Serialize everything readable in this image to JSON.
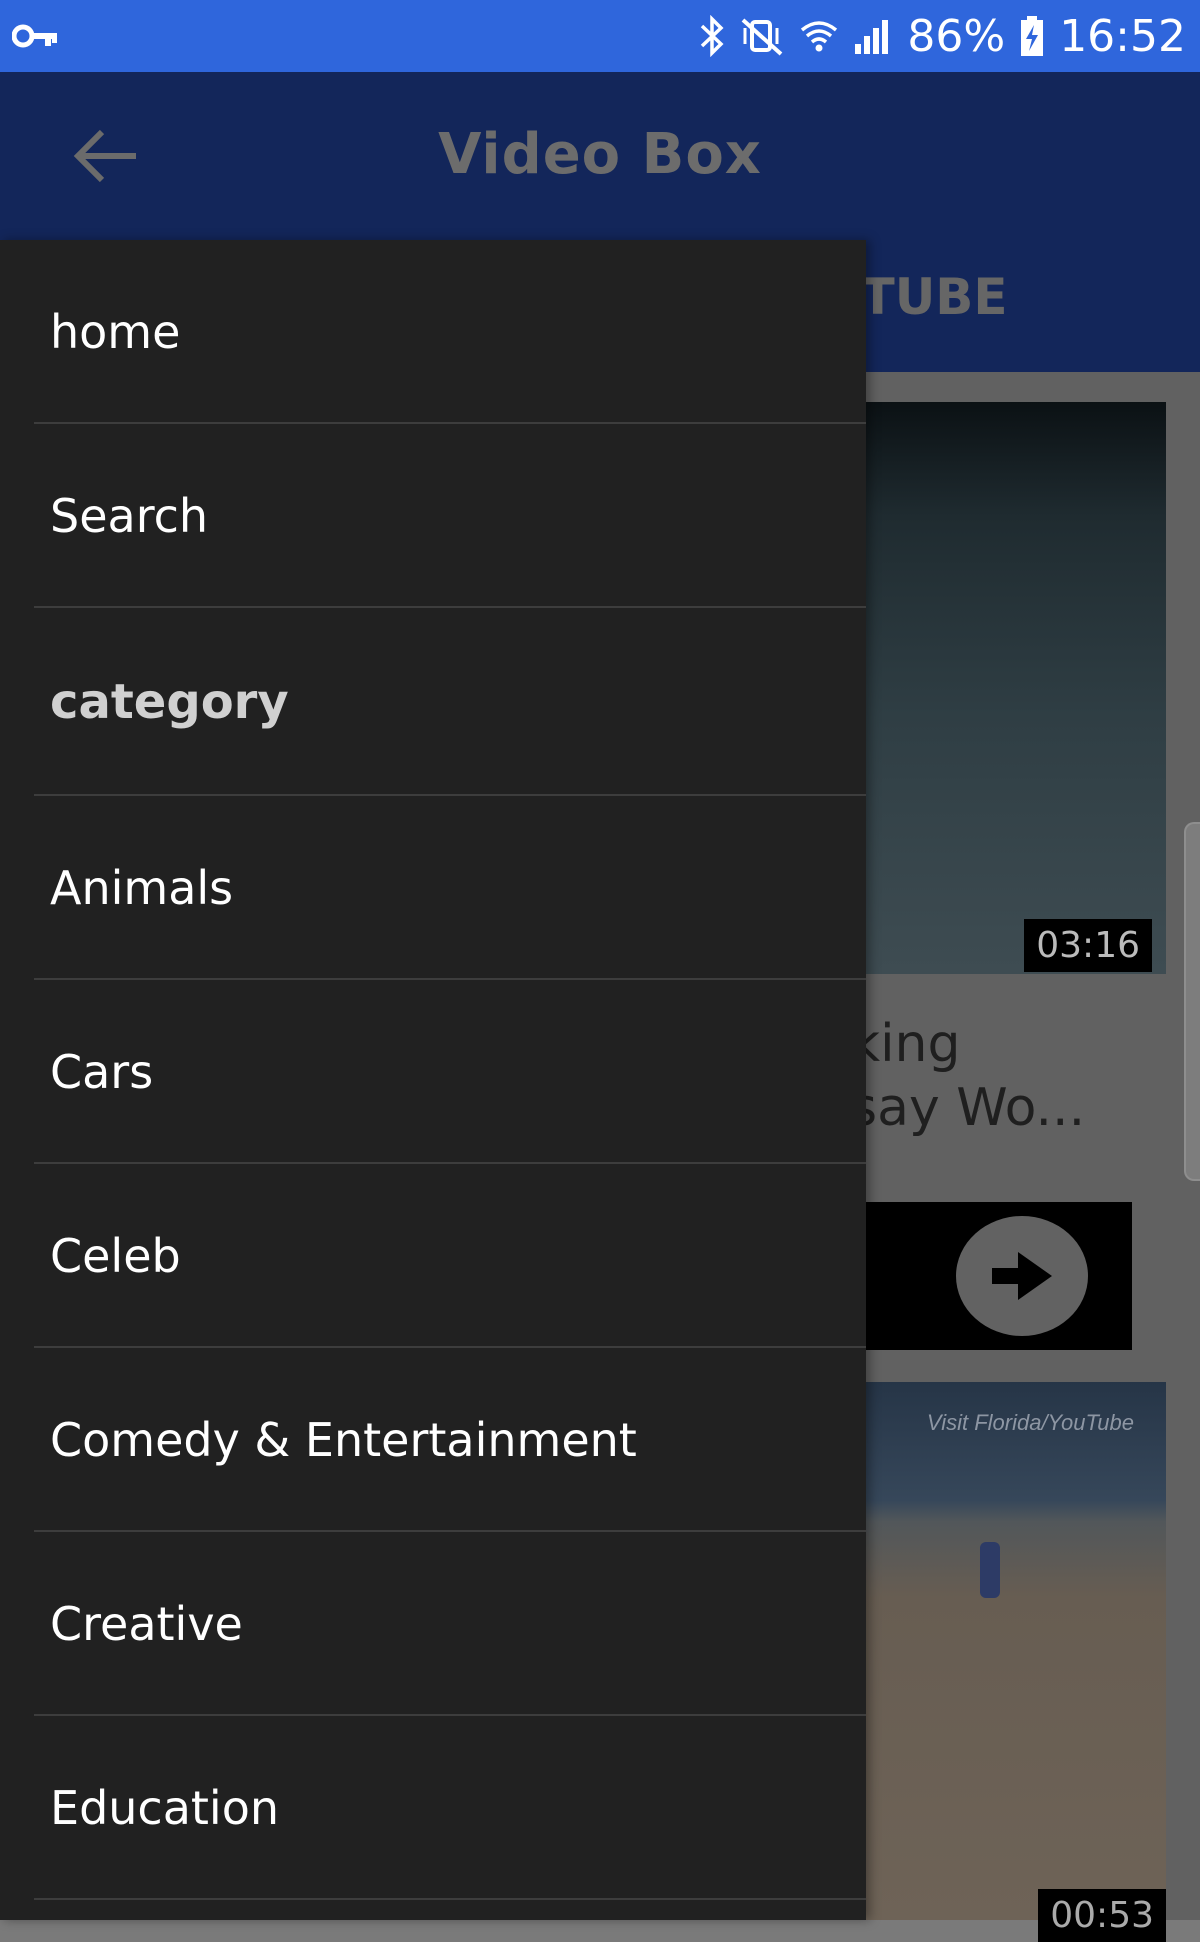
{
  "status_bar": {
    "battery_percent": "86%",
    "time": "16:52",
    "icons": [
      "vpn-key-icon",
      "bluetooth-icon",
      "vibrate-mute-icon",
      "wifi-icon",
      "signal-icon",
      "battery-charging-icon"
    ]
  },
  "app_bar": {
    "title": "Video Box",
    "back_icon": "arrow-left-icon"
  },
  "tabs": {
    "visible_label": "UTUBE"
  },
  "background_content": {
    "video1": {
      "duration": "03:16",
      "title_fragment": "king\nsay Wo..."
    },
    "video2": {
      "watermark": "Visit Florida/YouTube",
      "duration": "00:53"
    },
    "next_icon": "arrow-right-circle-icon"
  },
  "drawer": {
    "items": [
      {
        "label": "home",
        "header": false
      },
      {
        "label": "Search",
        "header": false
      },
      {
        "label": "category",
        "header": true
      },
      {
        "label": "Animals",
        "header": false
      },
      {
        "label": "Cars",
        "header": false
      },
      {
        "label": "Celeb",
        "header": false
      },
      {
        "label": "Comedy & Entertainment",
        "header": false
      },
      {
        "label": "Creative",
        "header": false
      },
      {
        "label": "Education",
        "header": false
      }
    ]
  },
  "colors": {
    "status_bar": "#2f66dc",
    "app_bar": "#13265a",
    "drawer_bg": "#212121",
    "scrim": "#616161"
  }
}
